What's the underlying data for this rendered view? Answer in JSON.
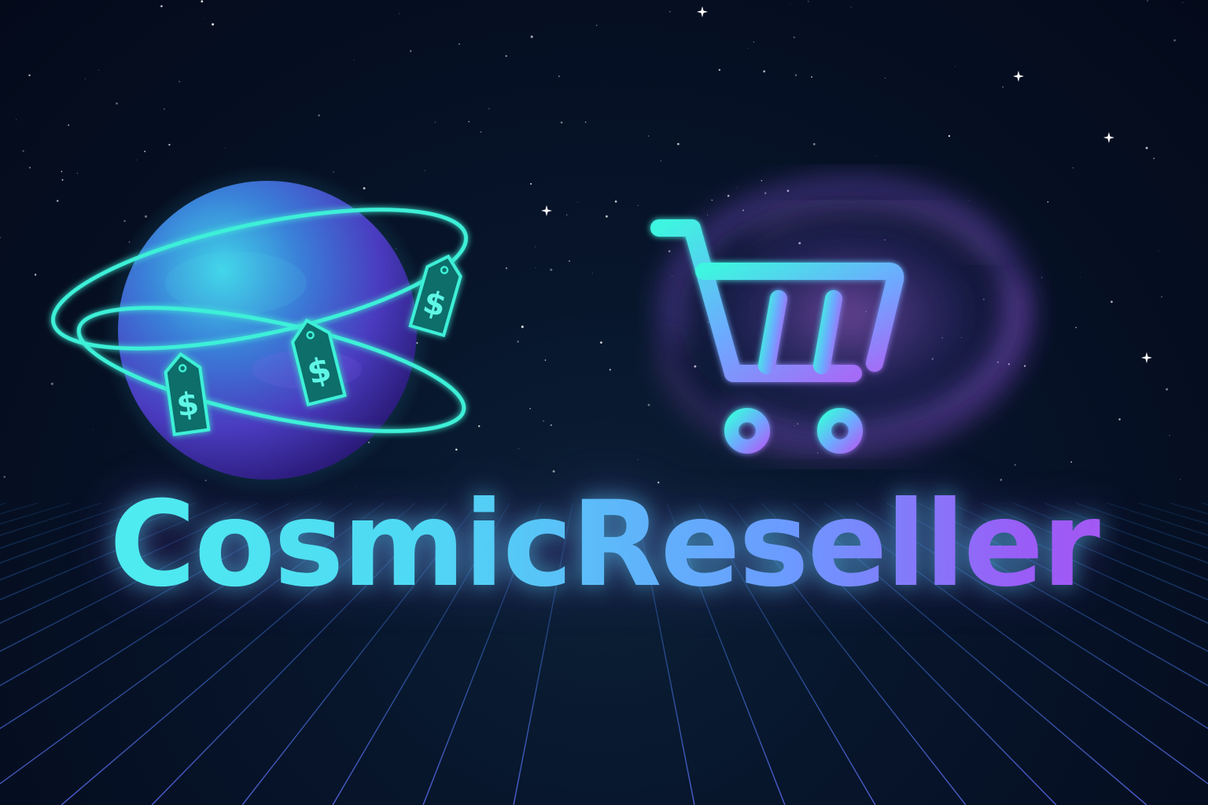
{
  "brand": {
    "name": "CosmicReseller"
  },
  "icons": {
    "planet": "planet-with-orbits-icon",
    "price_tag": "price-tag-icon",
    "cart": "shopping-cart-icon",
    "galaxy": "spiral-galaxy-icon"
  },
  "price_tags": [
    {
      "symbol": "$"
    },
    {
      "symbol": "$"
    },
    {
      "symbol": "$"
    }
  ],
  "colors": {
    "background": "#050b1c",
    "cyan": "#4ef4ee",
    "blue": "#6b9bff",
    "purple": "#9a5cf6",
    "grid": "#2a7fd0"
  }
}
